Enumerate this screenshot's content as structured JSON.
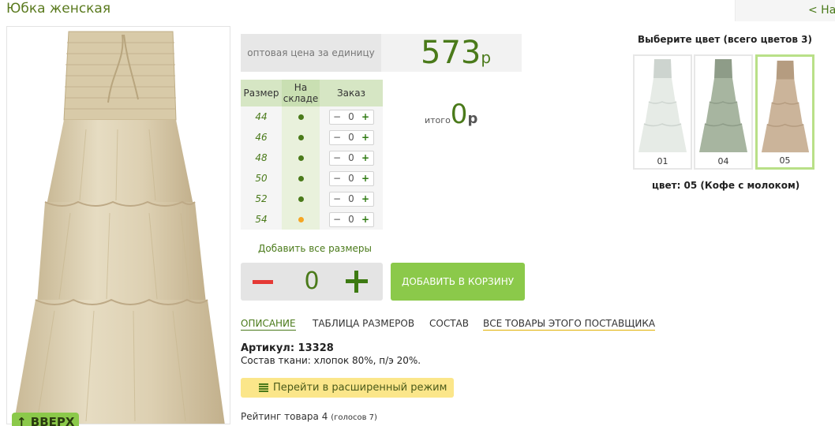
{
  "page": {
    "title": "Юбка женская",
    "back_link": "< Наз"
  },
  "price": {
    "label": "оптовая цена за единицу",
    "value": "573",
    "currency": "р"
  },
  "size_table": {
    "headers": [
      "Размер",
      "На складе",
      "Заказ"
    ],
    "rows": [
      {
        "size": "44",
        "stock": "in-stock",
        "qty": "0"
      },
      {
        "size": "46",
        "stock": "in-stock",
        "qty": "0"
      },
      {
        "size": "48",
        "stock": "in-stock",
        "qty": "0"
      },
      {
        "size": "50",
        "stock": "in-stock",
        "qty": "0"
      },
      {
        "size": "52",
        "stock": "in-stock",
        "qty": "0"
      },
      {
        "size": "54",
        "stock": "low-stock",
        "qty": "0"
      }
    ],
    "minus": "−",
    "plus": "+"
  },
  "total": {
    "label": "итого",
    "value": "0",
    "currency": "р"
  },
  "add_all_sizes": "Добавить все размеры",
  "quantity": {
    "value": "0"
  },
  "add_to_cart": "ДОБАВИТЬ В КОРЗИНУ",
  "tabs": [
    {
      "label": "ОПИСАНИЕ",
      "active": true
    },
    {
      "label": "ТАБЛИЦА РАЗМЕРОВ",
      "active": false
    },
    {
      "label": "СОСТАВ",
      "active": false
    },
    {
      "label": "ВСЕ ТОВАРЫ ЭТОГО ПОСТАВЩИКА",
      "active": false
    }
  ],
  "description": {
    "article": "Артикул: 13328",
    "composition": "Состав ткани: хлопок 80%, п/э 20%."
  },
  "advanced_mode": "Перейти в расширенный режим",
  "rating": {
    "text": "Рейтинг товара 4",
    "votes": "(голосов 7)"
  },
  "scroll_up": "↑ ВВЕРХ",
  "colors": {
    "heading": "Выберите цвет (всего цветов 3)",
    "options": [
      {
        "code": "01",
        "color": "#e6ebe6",
        "shade": "#cdd4cf"
      },
      {
        "code": "04",
        "color": "#a7b5a0",
        "shade": "#8e9c88"
      },
      {
        "code": "05",
        "color": "#cbb49a",
        "shade": "#b59c80"
      }
    ],
    "selected_label": "цвет: 05 (Кофе с молоком)"
  },
  "product_color": "#dcd0b4"
}
